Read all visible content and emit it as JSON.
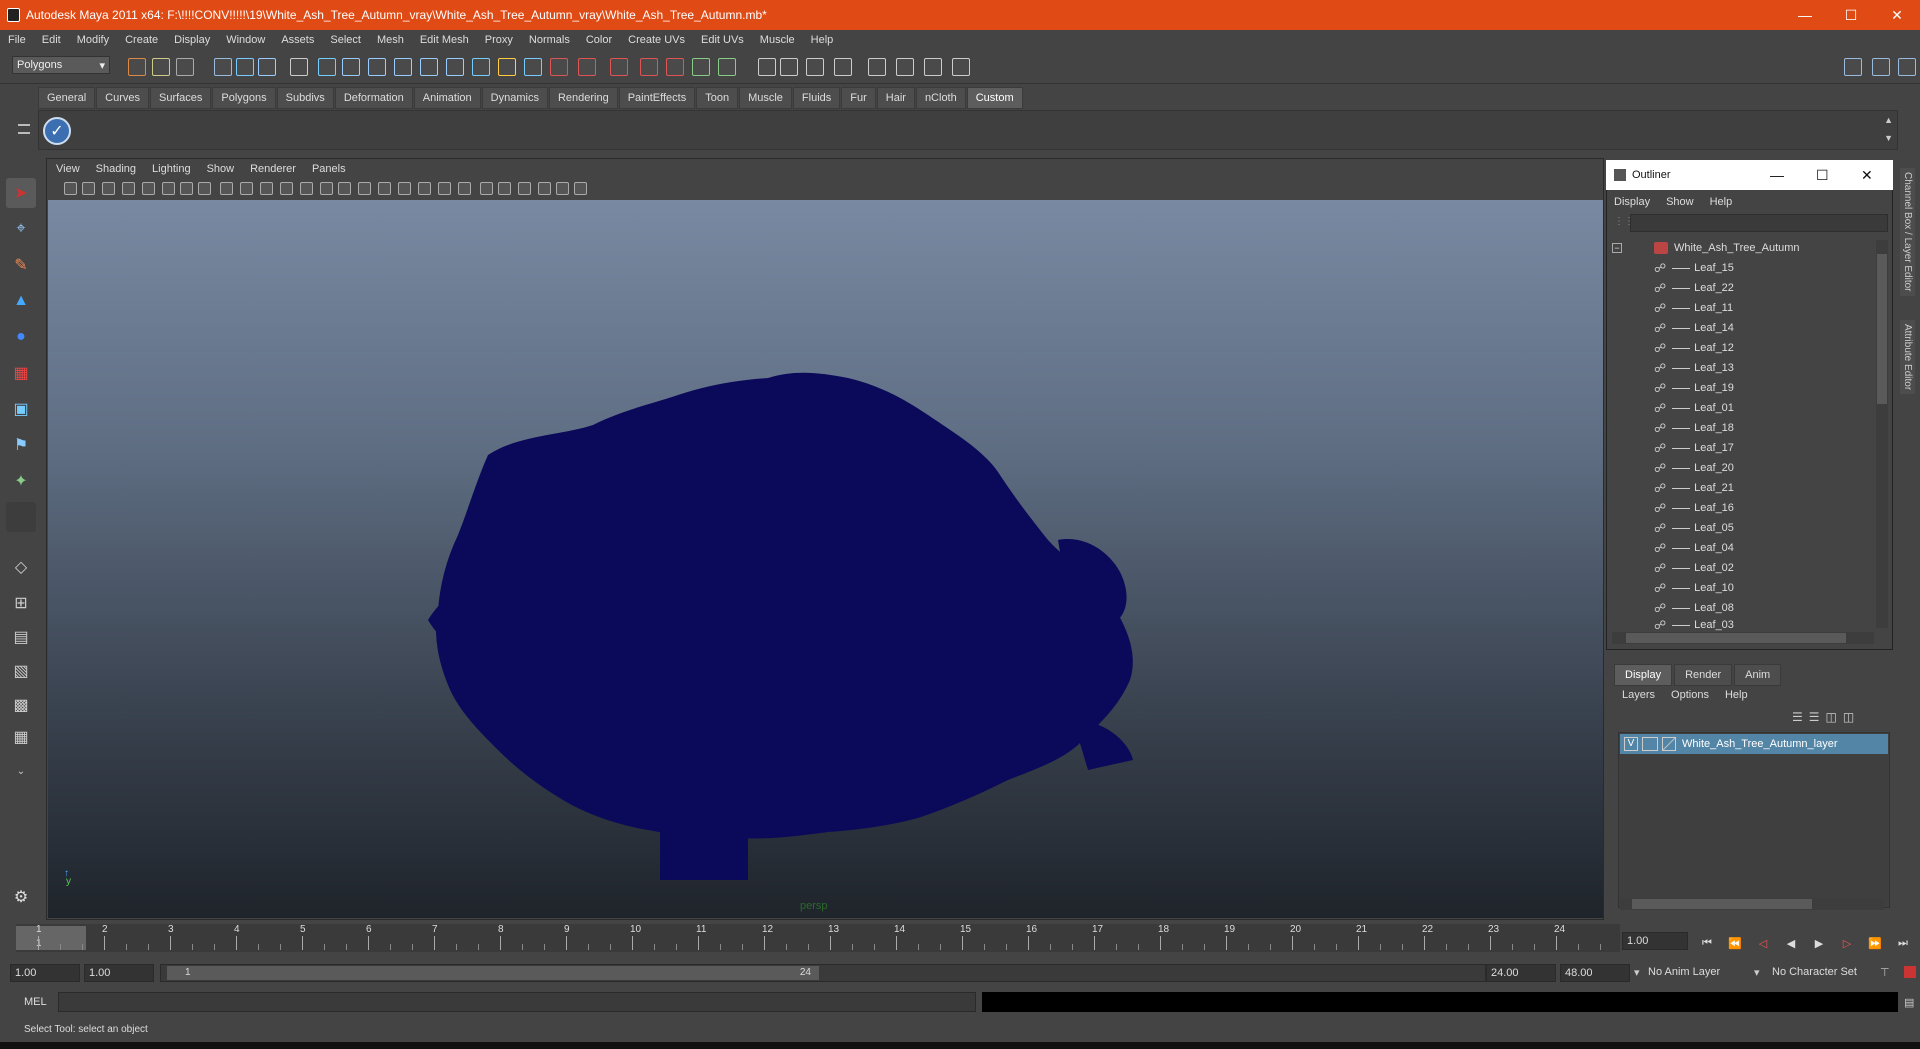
{
  "window": {
    "title": "Autodesk Maya 2011 x64: F:\\!!!!CONV!!!!!\\19\\White_Ash_Tree_Autumn_vray\\White_Ash_Tree_Autumn_vray\\White_Ash_Tree_Autumn.mb*"
  },
  "menubar": [
    "File",
    "Edit",
    "Modify",
    "Create",
    "Display",
    "Window",
    "Assets",
    "Select",
    "Mesh",
    "Edit Mesh",
    "Proxy",
    "Normals",
    "Color",
    "Create UVs",
    "Edit UVs",
    "Muscle",
    "Help"
  ],
  "mode_selector": "Polygons",
  "shelf_tabs": [
    "General",
    "Curves",
    "Surfaces",
    "Polygons",
    "Subdivs",
    "Deformation",
    "Animation",
    "Dynamics",
    "Rendering",
    "PaintEffects",
    "Toon",
    "Muscle",
    "Fluids",
    "Fur",
    "Hair",
    "nCloth",
    "Custom"
  ],
  "viewport": {
    "menu": [
      "View",
      "Shading",
      "Lighting",
      "Show",
      "Renderer",
      "Panels"
    ],
    "camera_label": "persp",
    "axis_label": "y"
  },
  "outliner": {
    "title": "Outliner",
    "menu": [
      "Display",
      "Show",
      "Help"
    ],
    "root": "White_Ash_Tree_Autumn",
    "items": [
      "Leaf_15",
      "Leaf_22",
      "Leaf_11",
      "Leaf_14",
      "Leaf_12",
      "Leaf_13",
      "Leaf_19",
      "Leaf_01",
      "Leaf_18",
      "Leaf_17",
      "Leaf_20",
      "Leaf_21",
      "Leaf_16",
      "Leaf_05",
      "Leaf_04",
      "Leaf_02",
      "Leaf_10",
      "Leaf_08",
      "Leaf_03"
    ]
  },
  "layer_editor": {
    "tabs": [
      "Display",
      "Render",
      "Anim"
    ],
    "menu": [
      "Layers",
      "Options",
      "Help"
    ],
    "layer_visibility": "V",
    "layer_name": "White_Ash_Tree_Autumn_layer"
  },
  "side_tabs": [
    "Channel Box / Layer Editor",
    "Attribute Editor"
  ],
  "timeline": {
    "ticks": [
      "1",
      "2",
      "3",
      "4",
      "5",
      "6",
      "7",
      "8",
      "9",
      "10",
      "11",
      "12",
      "13",
      "14",
      "15",
      "16",
      "17",
      "18",
      "19",
      "20",
      "21",
      "22",
      "23",
      "24"
    ],
    "current_frame_label": "1",
    "current_time": "1.00"
  },
  "range": {
    "start": "1.00",
    "playback_start": "1.00",
    "slider_start": "1",
    "slider_end": "24",
    "playback_end": "24.00",
    "end": "48.00",
    "anim_layer": "No Anim Layer",
    "character_set": "No Character Set"
  },
  "mel": {
    "label": "MEL"
  },
  "help_line": "Select Tool: select an object",
  "colors": {
    "title_bar": "#e04a14",
    "tree": "#0b0a5a",
    "layer_highlight": "#5285a6"
  }
}
